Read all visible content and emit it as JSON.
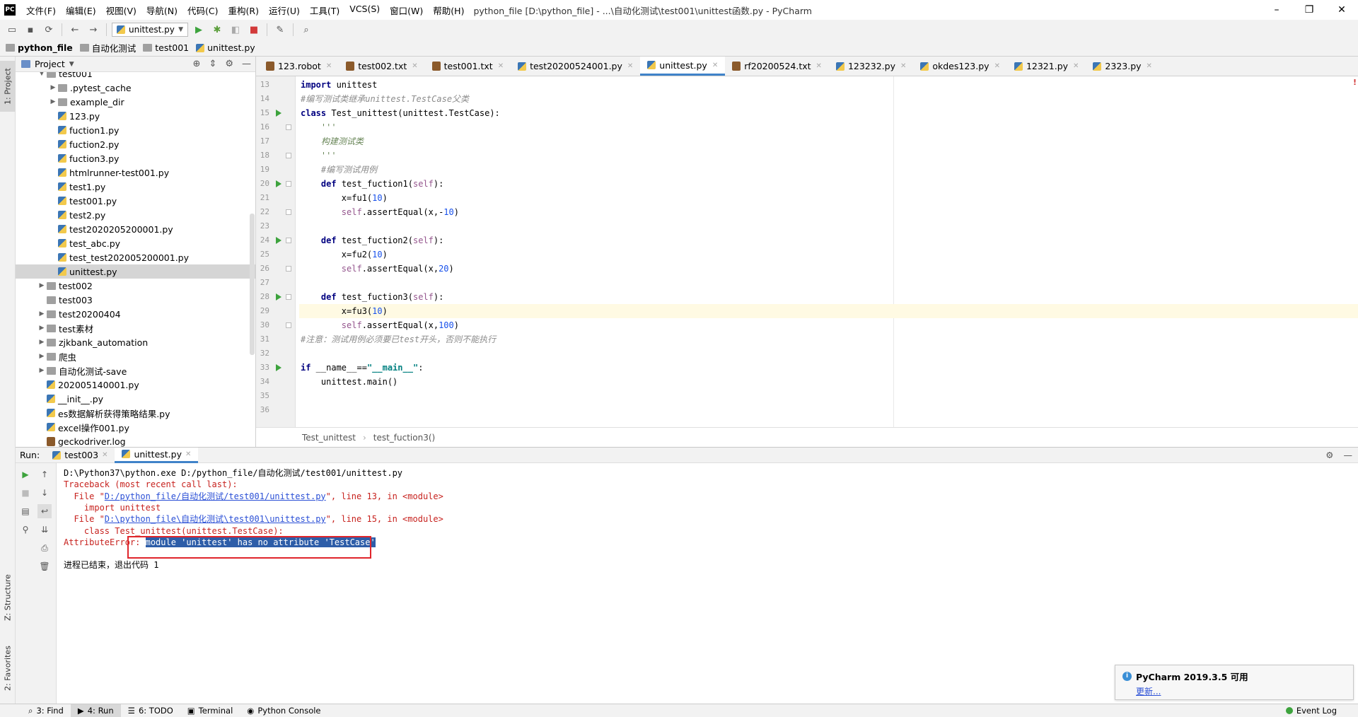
{
  "app": {
    "logo": "PC",
    "title": "python_file [D:\\python_file] - ...\\自动化测试\\test001\\unittest函数.py - PyCharm"
  },
  "menu": [
    "文件(F)",
    "编辑(E)",
    "视图(V)",
    "导航(N)",
    "代码(C)",
    "重构(R)",
    "运行(U)",
    "工具(T)",
    "VCS(S)",
    "窗口(W)",
    "帮助(H)"
  ],
  "window_controls": {
    "minimize": "–",
    "maximize": "❐",
    "close": "✕"
  },
  "toolbar": {
    "run_config": "unittest.py"
  },
  "navbar": [
    "python_file",
    "自动化测试",
    "test001",
    "unittest.py"
  ],
  "left_tools": {
    "project_tab": "1: Project",
    "structure_tab": "Z: Structure",
    "favorites_tab": "2: Favorites"
  },
  "project": {
    "header": "Project",
    "items": [
      {
        "label": "test001",
        "level": 2,
        "type": "folder",
        "expand": "open"
      },
      {
        "label": ".pytest_cache",
        "level": 3,
        "type": "folder",
        "expand": "closed"
      },
      {
        "label": "example_dir",
        "level": 3,
        "type": "folder",
        "expand": "closed"
      },
      {
        "label": "123.py",
        "level": 3,
        "type": "py",
        "expand": ""
      },
      {
        "label": "fuction1.py",
        "level": 3,
        "type": "py",
        "expand": ""
      },
      {
        "label": "fuction2.py",
        "level": 3,
        "type": "py",
        "expand": ""
      },
      {
        "label": "fuction3.py",
        "level": 3,
        "type": "py",
        "expand": ""
      },
      {
        "label": "htmlrunner-test001.py",
        "level": 3,
        "type": "py",
        "expand": ""
      },
      {
        "label": "test1.py",
        "level": 3,
        "type": "py",
        "expand": ""
      },
      {
        "label": "test001.py",
        "level": 3,
        "type": "py",
        "expand": ""
      },
      {
        "label": "test2.py",
        "level": 3,
        "type": "py",
        "expand": ""
      },
      {
        "label": "test2020205200001.py",
        "level": 3,
        "type": "py",
        "expand": ""
      },
      {
        "label": "test_abc.py",
        "level": 3,
        "type": "py",
        "expand": ""
      },
      {
        "label": "test_test202005200001.py",
        "level": 3,
        "type": "py",
        "expand": ""
      },
      {
        "label": "unittest.py",
        "level": 3,
        "type": "py",
        "expand": "",
        "selected": true
      },
      {
        "label": "test002",
        "level": 2,
        "type": "folder",
        "expand": "closed"
      },
      {
        "label": "test003",
        "level": 2,
        "type": "folder",
        "expand": ""
      },
      {
        "label": "test20200404",
        "level": 2,
        "type": "folder",
        "expand": "closed"
      },
      {
        "label": "test素材",
        "level": 2,
        "type": "folder",
        "expand": "closed"
      },
      {
        "label": "zjkbank_automation",
        "level": 2,
        "type": "folder",
        "expand": "closed"
      },
      {
        "label": "爬虫",
        "level": 2,
        "type": "folder",
        "expand": "closed"
      },
      {
        "label": "自动化测试-save",
        "level": 2,
        "type": "folder",
        "expand": "closed"
      },
      {
        "label": "202005140001.py",
        "level": 2,
        "type": "py",
        "expand": ""
      },
      {
        "label": "__init__.py",
        "level": 2,
        "type": "py",
        "expand": ""
      },
      {
        "label": "es数据解析获得策略结果.py",
        "level": 2,
        "type": "py",
        "expand": ""
      },
      {
        "label": "excel操作001.py",
        "level": 2,
        "type": "py",
        "expand": ""
      },
      {
        "label": "geckodriver.log",
        "level": 2,
        "type": "txt",
        "expand": ""
      }
    ]
  },
  "tabs": [
    {
      "label": "123.robot",
      "icon": "txt"
    },
    {
      "label": "test002.txt",
      "icon": "txt"
    },
    {
      "label": "test001.txt",
      "icon": "txt"
    },
    {
      "label": "test20200524001.py",
      "icon": "py"
    },
    {
      "label": "unittest.py",
      "icon": "py",
      "active": true
    },
    {
      "label": "rf20200524.txt",
      "icon": "txt"
    },
    {
      "label": "123232.py",
      "icon": "py"
    },
    {
      "label": "okdes123.py",
      "icon": "py"
    },
    {
      "label": "12321.py",
      "icon": "py"
    },
    {
      "label": "2323.py",
      "icon": "py"
    }
  ],
  "code": {
    "lines": [
      {
        "n": "13",
        "html": "<span class=\"kw\">import</span> unittest",
        "run": false,
        "fold": false
      },
      {
        "n": "14",
        "html": "<span class=\"cm\">#编写测试类继承unittest.TestCase父类</span>",
        "run": false,
        "fold": false
      },
      {
        "n": "15",
        "html": "<span class=\"kw\">class</span> Test_unittest(unittest.TestCase):",
        "run": true,
        "fold": false
      },
      {
        "n": "16",
        "html": "    <span class=\"doc\">'''</span>",
        "run": false,
        "fold": true
      },
      {
        "n": "17",
        "html": "    <span class=\"doc\">构建测试类</span>",
        "run": false,
        "fold": false
      },
      {
        "n": "18",
        "html": "    <span class=\"doc\">'''</span>",
        "run": false,
        "fold": true
      },
      {
        "n": "19",
        "html": "    <span class=\"cm\">#编写测试用例</span>",
        "run": false,
        "fold": false
      },
      {
        "n": "20",
        "html": "    <span class=\"kw\">def</span> test_fuction1(<span class=\"slf\">self</span>):",
        "run": true,
        "fold": true
      },
      {
        "n": "21",
        "html": "        x=fu1(<span class=\"num\">10</span>)",
        "run": false,
        "fold": false
      },
      {
        "n": "22",
        "html": "        <span class=\"slf\">self</span>.assertEqual(x,-<span class=\"num\">10</span>)",
        "run": false,
        "fold": true
      },
      {
        "n": "23",
        "html": "",
        "run": false,
        "fold": false
      },
      {
        "n": "24",
        "html": "    <span class=\"kw\">def</span> test_fuction2(<span class=\"slf\">self</span>):",
        "run": true,
        "fold": true
      },
      {
        "n": "25",
        "html": "        x=fu2(<span class=\"num\">10</span>)",
        "run": false,
        "fold": false
      },
      {
        "n": "26",
        "html": "        <span class=\"slf\">self</span>.assertEqual(x,<span class=\"num\">20</span>)",
        "run": false,
        "fold": true
      },
      {
        "n": "27",
        "html": "",
        "run": false,
        "fold": false
      },
      {
        "n": "28",
        "html": "    <span class=\"kw\">def</span> test_fuction3(<span class=\"slf\">self</span>):",
        "run": true,
        "fold": true
      },
      {
        "n": "29",
        "html": "        x=fu3(<span class=\"num\">10</span>)",
        "run": false,
        "fold": false,
        "current": true
      },
      {
        "n": "30",
        "html": "        <span class=\"slf\">self</span>.assertEqual(x,<span class=\"num\">100</span>)",
        "run": false,
        "fold": true
      },
      {
        "n": "31",
        "html": "<span class=\"cm\">#注意：测试用例必须要已test开头，否则不能执行</span>",
        "run": false,
        "fold": false
      },
      {
        "n": "32",
        "html": "",
        "run": false,
        "fold": false
      },
      {
        "n": "33",
        "html": "<span class=\"kw\">if</span> __name__==<span class=\"str\">\"__main__\"</span>:",
        "run": true,
        "fold": false
      },
      {
        "n": "34",
        "html": "    unittest.main()",
        "run": false,
        "fold": false
      },
      {
        "n": "35",
        "html": "",
        "run": false,
        "fold": false
      },
      {
        "n": "36",
        "html": "",
        "run": false,
        "fold": false
      }
    ],
    "crumbs": [
      "Test_unittest",
      "test_fuction3()"
    ]
  },
  "run": {
    "label": "Run:",
    "tabs": [
      {
        "label": "test003",
        "active": false
      },
      {
        "label": "unittest.py",
        "active": true
      }
    ],
    "console": [
      {
        "html": "D:\\Python37\\python.exe D:/python_file/自动化测试/test001/unittest.py"
      },
      {
        "html": "<span class=\"red\">Traceback (most recent call last):</span>"
      },
      {
        "html": "<span class=\"red\">  File \"<span class=\"link\">D:/python_file/自动化测试/test001/unittest.py</span>\", line 13, in &lt;module&gt;</span>"
      },
      {
        "html": "<span class=\"red\">    import unittest</span>"
      },
      {
        "html": "<span class=\"red\">  File \"<span class=\"link\">D:\\python_file\\自动化测试\\test001\\unittest.py</span>\", line 15, in &lt;module&gt;</span>"
      },
      {
        "html": "<span class=\"red\">    class Test_unittest(unittest.TestCase):</span>"
      },
      {
        "html": "<span class=\"red\">AttributeError: </span><span class=\"seltext\">module 'unittest' has no attribute 'TestCase'</span>"
      },
      {
        "html": ""
      },
      {
        "html": "进程已结束，退出代码 1"
      }
    ]
  },
  "notification": {
    "title": "PyCharm 2019.3.5 可用",
    "action": "更新..."
  },
  "statusbar": [
    {
      "label": "3: Find",
      "icon": "⌕",
      "active": false
    },
    {
      "label": "4: Run",
      "icon": "▶",
      "active": true
    },
    {
      "label": "6: TODO",
      "icon": "☰",
      "active": false
    },
    {
      "label": "Terminal",
      "icon": "▣",
      "active": false
    },
    {
      "label": "Python Console",
      "icon": "◉",
      "active": false
    }
  ],
  "event_log": "Event Log"
}
